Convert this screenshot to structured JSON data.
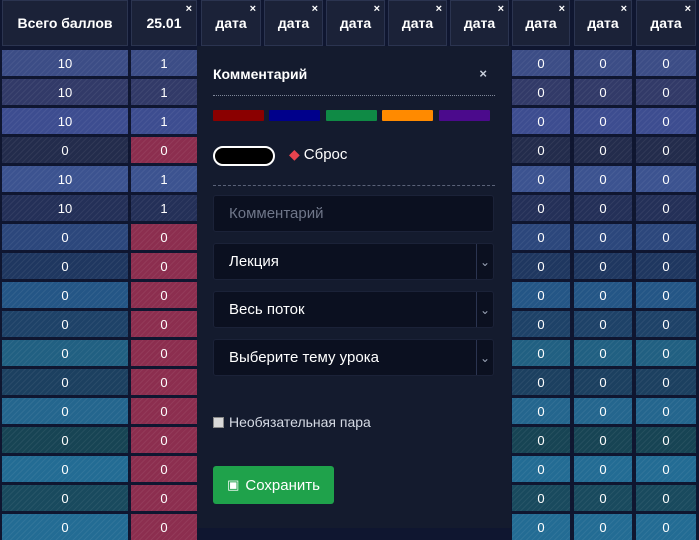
{
  "header": {
    "total_label": "Всего баллов",
    "date_labels": [
      "25.01",
      "дата",
      "дата",
      "дата",
      "дата",
      "дата",
      "дата",
      "дата",
      "дата"
    ],
    "close_glyph": "×"
  },
  "rows": [
    {
      "total": "10",
      "first": "1",
      "rest": "0"
    },
    {
      "total": "10",
      "first": "1",
      "rest": "0"
    },
    {
      "total": "10",
      "first": "1",
      "rest": "0"
    },
    {
      "total": "0",
      "first": "0",
      "rest": "0"
    },
    {
      "total": "10",
      "first": "1",
      "rest": "0"
    },
    {
      "total": "10",
      "first": "1",
      "rest": "0"
    },
    {
      "total": "0",
      "first": "0",
      "rest": "0"
    },
    {
      "total": "0",
      "first": "0",
      "rest": "0"
    },
    {
      "total": "0",
      "first": "0",
      "rest": "0"
    },
    {
      "total": "0",
      "first": "0",
      "rest": "0"
    },
    {
      "total": "0",
      "first": "0",
      "rest": "0"
    },
    {
      "total": "0",
      "first": "0",
      "rest": "0"
    },
    {
      "total": "0",
      "first": "0",
      "rest": "0"
    },
    {
      "total": "0",
      "first": "0",
      "rest": "0"
    },
    {
      "total": "0",
      "first": "0",
      "rest": "0"
    },
    {
      "total": "0",
      "first": "0",
      "rest": "0"
    },
    {
      "total": "0",
      "first": "0",
      "rest": "0"
    }
  ],
  "row_colors": [
    "#3c4d86",
    "#323a68",
    "#3d4d90",
    "#232c4c",
    "#3c5390",
    "#243058",
    "#2c477c",
    "#1f3760",
    "#245686",
    "#1e4268",
    "#216082",
    "#1c4060",
    "#24668e",
    "#174454",
    "#236c94",
    "#194a5e",
    "#236c94"
  ],
  "first_col_color_zero": "#8c2e4f",
  "panel": {
    "title": "Комментарий",
    "close_glyph": "×",
    "swatches": [
      "#8b0000",
      "#00008b",
      "#0f8a45",
      "#ff8a00",
      "#4b0a8c"
    ],
    "selected_color": "#000000",
    "reset_label": "Сброс",
    "reset_icon": "eraser-icon",
    "comment_placeholder": "Комментарий",
    "type_select": "Лекция",
    "audience_select": "Весь поток",
    "topic_select": "Выберите тему урока",
    "optional_label": "Необязательная пара",
    "save_label": "Сохранить",
    "save_icon": "floppy-icon"
  }
}
